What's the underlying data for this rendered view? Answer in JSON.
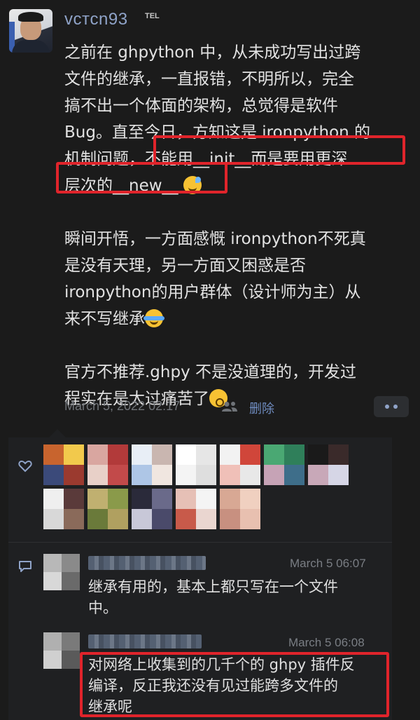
{
  "post": {
    "username": "vcтcn93",
    "badge": "TEL",
    "para1_line1": "之前在 ghpython 中，从未成功写出过跨",
    "para1_line2": "文件的继承，一直报错，不明所以，完全",
    "para1_line3": "搞不出一个体面的架构，总觉得是软件",
    "para1_line4": "Bug。直至今日，方知这是 ironpython 的",
    "para1_line5a": "机制问题，",
    "para1_line5b": "不能用__init__而是要用更深",
    "para1_line6": "层次的__new__",
    "para2_line1": "瞬间开悟，一方面感慨 ironpython不死真",
    "para2_line2": "是没有天理，另一方面又困惑是否",
    "para2_line3": "ironpython的用户群体（设计师为主）从",
    "para2_line4": "来不写继承",
    "para3_line1": "官方不推荐.ghpy 不是没道理的，开发过",
    "para3_line2": "程实在是太过痛苦了",
    "timestamp": "March 5, 2022 02:17",
    "delete_label": "删除"
  },
  "comments": [
    {
      "time": "March 5 06:07",
      "line1": "继承有用的，基本上都只写在一个文件",
      "line2": "中。"
    },
    {
      "time": "March 5 06:08",
      "line1": "对网络上收集到的几千个的 ghpy 插件反",
      "line2": "编译，反正我还没有见过能跨多文件的",
      "line3": "继承呢"
    }
  ],
  "colors": {
    "highlight": "#e0242b",
    "link": "#8fa3c8"
  },
  "icons": [
    "heart-icon",
    "comment-icon",
    "friends-icon",
    "more-icon"
  ]
}
